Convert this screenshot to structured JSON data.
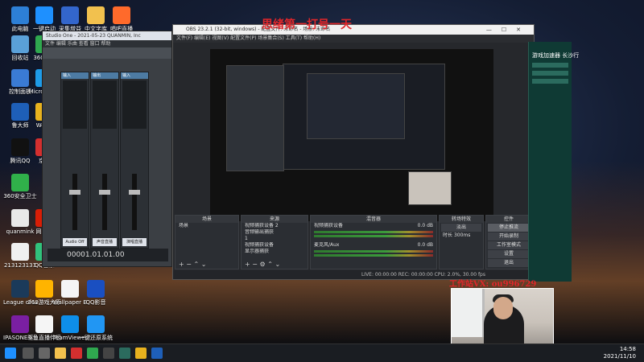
{
  "desktop_icons": [
    {
      "label": "此电脑",
      "icon": "pc-icon",
      "color": "#2d7fd6"
    },
    {
      "label": "一键启动",
      "icon": "app-icon",
      "color": "#1e90ff"
    },
    {
      "label": "采集增益",
      "icon": "audio-icon",
      "color": "#3366cc"
    },
    {
      "label": "中文字库",
      "icon": "folder-icon",
      "color": "#f2c14e"
    },
    {
      "label": "唱吧直播",
      "icon": "mic-icon",
      "color": "#ff6a2b"
    },
    {
      "label": "回收站",
      "icon": "recycle-bin-icon",
      "color": "#5aa0d8"
    },
    {
      "label": "360安全",
      "icon": "shield-icon",
      "color": "#2fa84f"
    },
    {
      "label": "控制面板",
      "icon": "control-panel-icon",
      "color": "#3a7bd5"
    },
    {
      "label": "Micro Edge",
      "icon": "edge-icon",
      "color": "#1e9be8"
    },
    {
      "label": "鲁大师",
      "icon": "ludashi-icon",
      "color": "#1e5fb8"
    },
    {
      "label": "WeGa",
      "icon": "wegame-icon",
      "color": "#e8b21e"
    },
    {
      "label": "腾讯QQ",
      "icon": "qq-icon",
      "color": "#111111"
    },
    {
      "label": "京东",
      "icon": "jd-icon",
      "color": "#d32f2f"
    },
    {
      "label": "360安全卫士",
      "icon": "guard-icon",
      "color": "#30b04a"
    },
    {
      "label": "quanmink",
      "icon": "file-icon",
      "color": "#e8e8e8"
    },
    {
      "label": "网易云",
      "icon": "music-icon",
      "color": "#d81e06"
    },
    {
      "label": "213123131",
      "icon": "doc-icon",
      "color": "#f0f0f0"
    },
    {
      "label": "QQ音乐",
      "icon": "qqmusic-icon",
      "color": "#31c27c"
    },
    {
      "label": "League of Legends",
      "icon": "lol-icon",
      "color": "#1b3a5a"
    },
    {
      "label": "360游戏大厅",
      "icon": "game-hall-icon",
      "color": "#ffb400"
    },
    {
      "label": "Wallpaper Engine",
      "icon": "wallpaper-icon",
      "color": "#f5f5f5"
    },
    {
      "label": "QQ影音",
      "icon": "qqplayer-icon",
      "color": "#1a4fc1"
    },
    {
      "label": "IPASONE驱动软件",
      "icon": "driver-icon",
      "color": "#7a1fa2"
    },
    {
      "label": "斗鱼直播伴侣",
      "icon": "douyu-icon",
      "color": "#f5f5f5"
    },
    {
      "label": "TeamViewer",
      "icon": "teamviewer-icon",
      "color": "#0e8ee9"
    },
    {
      "label": "一键还原系统",
      "icon": "restore-icon",
      "color": "#2196f3"
    }
  ],
  "studio": {
    "title": "Studio One - 2021-05-23 QUANMIN, Inc",
    "menu": "文件 编辑 乐曲 查看 窗口 帮助",
    "strips": [
      {
        "name": "输入",
        "foot": "Audio Off"
      },
      {
        "name": "输出",
        "foot": "声音直播"
      },
      {
        "name": "输入",
        "foot": "演唱直播"
      }
    ],
    "timecode": "00001.01.01.00"
  },
  "obs": {
    "title": "OBS 23.2.1 (32-bit, windows) - 配置文件: 未命名 - 场景: 未命名",
    "menu": "文件(F)  编辑(E)  视图(V)  配置文件(P)  场景集合(S)  工具(T)  帮助(H)",
    "docks": {
      "scenes": {
        "title": "场景",
        "items": [
          "场景"
        ]
      },
      "sources": {
        "title": "来源",
        "items": [
          "视频捕获设备 2",
          "音频输出捕获",
          "1",
          "视频捕获设备",
          "显示器捕获"
        ]
      },
      "mixer": {
        "title": "混音器",
        "tracks": [
          {
            "name": "视频捕获设备",
            "db": "0.0 dB"
          },
          {
            "name": "麦克风/Aux",
            "db": "0.0 dB"
          }
        ]
      },
      "transitions": {
        "title": "转场特效",
        "type": "淡出",
        "duration_label": "时长",
        "duration": "300ms"
      },
      "controls": {
        "title": "控件",
        "buttons": [
          "停止推流",
          "开始录制",
          "工作室模式",
          "设置",
          "退出"
        ]
      }
    },
    "status": "LIVE: 00:00:00    REC: 00:00:00    CPU: 2.0%, 30.00 fps"
  },
  "overlay": {
    "top_text": "思绪第一打号一天",
    "vx_text": "工作站VX: ou996729"
  },
  "green_window": {
    "title": "游戏加速器 长沙行"
  },
  "clock": {
    "time": "14:58",
    "date": "2021/11/10"
  }
}
